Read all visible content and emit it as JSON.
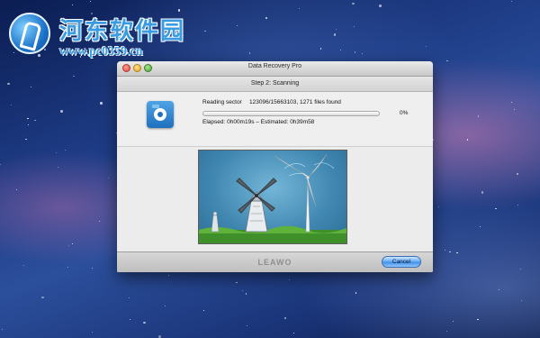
{
  "watermark": {
    "title": "河东软件园",
    "url": "www.pc0359.cn"
  },
  "window": {
    "title": "Data Recovery Pro",
    "step_title": "Step 2: Scanning",
    "reading_label": "Reading sector",
    "reading_value": "123096/15663103, 1271 files found",
    "progress_percent": 0,
    "percent_text": "0%",
    "elapsed_text": "Elapsed: 0h00m19s – Estimated: 0h39m58",
    "brand": "LEAWO",
    "cancel_label": "Cancel"
  },
  "icons": {
    "app_icon": "photo-recovery-icon",
    "close": "close-button",
    "minimize": "minimize-button",
    "zoom": "zoom-button"
  },
  "colors": {
    "accent": "#3e8fe6"
  }
}
